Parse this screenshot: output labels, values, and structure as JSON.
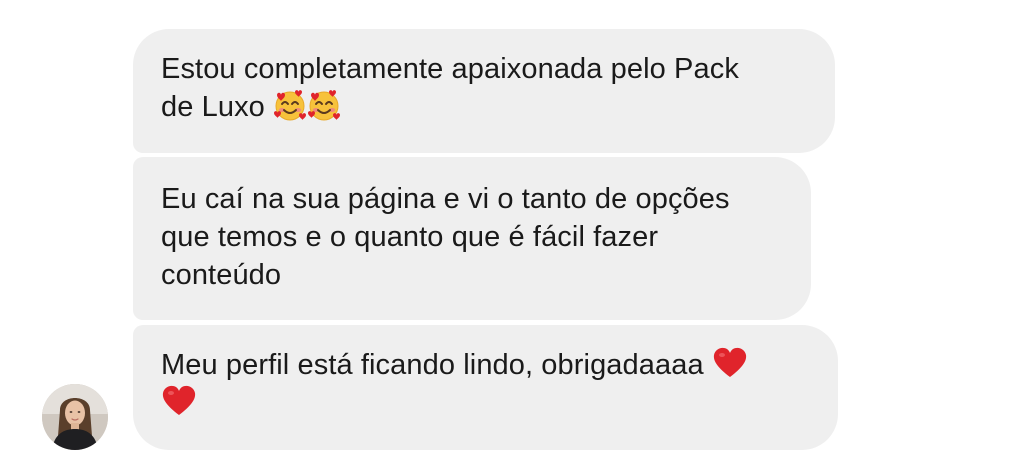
{
  "messages": [
    {
      "id": "msg-1",
      "text_line1": "Estou completamente apaixonada pelo Pack",
      "text_line2": "de Luxo",
      "emojis": [
        "smiling-face-with-hearts-icon",
        "smiling-face-with-hearts-icon"
      ]
    },
    {
      "id": "msg-2",
      "text_line1": "Eu caí na sua página e vi o tanto de opções",
      "text_line2": "que temos e o quanto que é fácil fazer",
      "text_line3": "conteúdo"
    },
    {
      "id": "msg-3",
      "text_line1": "Meu perfil está ficando lindo, obrigadaaaa",
      "emojis": [
        "red-heart-icon",
        "red-heart-icon"
      ]
    }
  ],
  "sender": {
    "avatar": "profile-photo"
  },
  "colors": {
    "bubble_background": "#efefef",
    "text": "#1a1a1a",
    "page_background": "#ffffff",
    "heart": "#e0242b"
  }
}
